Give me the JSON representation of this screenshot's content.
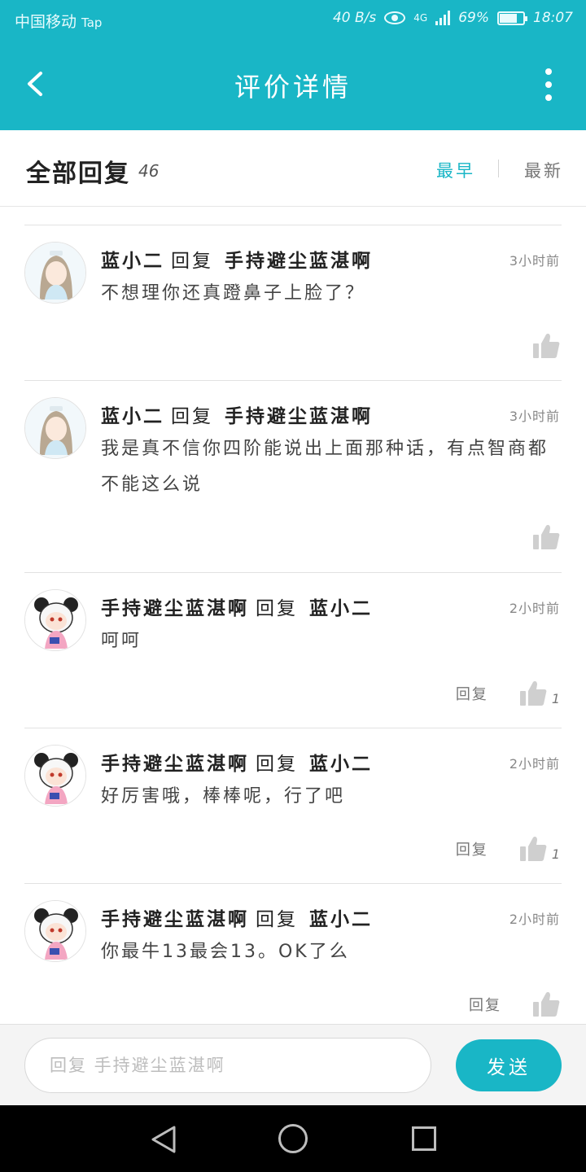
{
  "status_bar": {
    "carrier": "中国移动",
    "app": "Tap",
    "speed": "40 B/s",
    "network": "4G",
    "battery": "69%",
    "battery_level": 0.69,
    "time": "18:07"
  },
  "header": {
    "title": "评价详情"
  },
  "sort_bar": {
    "all_label": "全部回复",
    "count": "46",
    "earliest": "最早",
    "latest": "最新",
    "active": "earliest"
  },
  "replies": [
    {
      "author": "蓝小二",
      "verb": "回复",
      "target": "手持避尘蓝湛啊",
      "time": "3小时前",
      "text": "不想理你还真蹬鼻子上脸了？",
      "reply_label": "",
      "likes": ""
    },
    {
      "author": "蓝小二",
      "verb": "回复",
      "target": "手持避尘蓝湛啊",
      "time": "3小时前",
      "text": "我是真不信你四阶能说出上面那种话，有点智商都不能这么说",
      "reply_label": "",
      "likes": ""
    },
    {
      "author": "手持避尘蓝湛啊",
      "verb": "回复",
      "target": "蓝小二",
      "time": "2小时前",
      "text": "呵呵",
      "reply_label": "回复",
      "likes": "1"
    },
    {
      "author": "手持避尘蓝湛啊",
      "verb": "回复",
      "target": "蓝小二",
      "time": "2小时前",
      "text": "好厉害哦，棒棒呢，行了吧",
      "reply_label": "回复",
      "likes": "1"
    },
    {
      "author": "手持避尘蓝湛啊",
      "verb": "回复",
      "target": "蓝小二",
      "time": "2小时前",
      "text": "你最牛13最会13。OK了么",
      "reply_label": "回复",
      "likes": ""
    }
  ],
  "input_bar": {
    "placeholder": "回复 手持避尘蓝湛啊",
    "value": "",
    "send_label": "发送"
  },
  "icons": {
    "back": "chevron-left-icon",
    "more": "more-vertical-icon",
    "like": "thumbs-up-icon",
    "nav_back": "triangle-back-icon",
    "nav_home": "circle-home-icon",
    "nav_recent": "square-recent-icon"
  },
  "colors": {
    "accent": "#19b6c6",
    "text_primary": "#222222",
    "text_secondary": "#888888",
    "like_icon": "#cfcfcf"
  }
}
